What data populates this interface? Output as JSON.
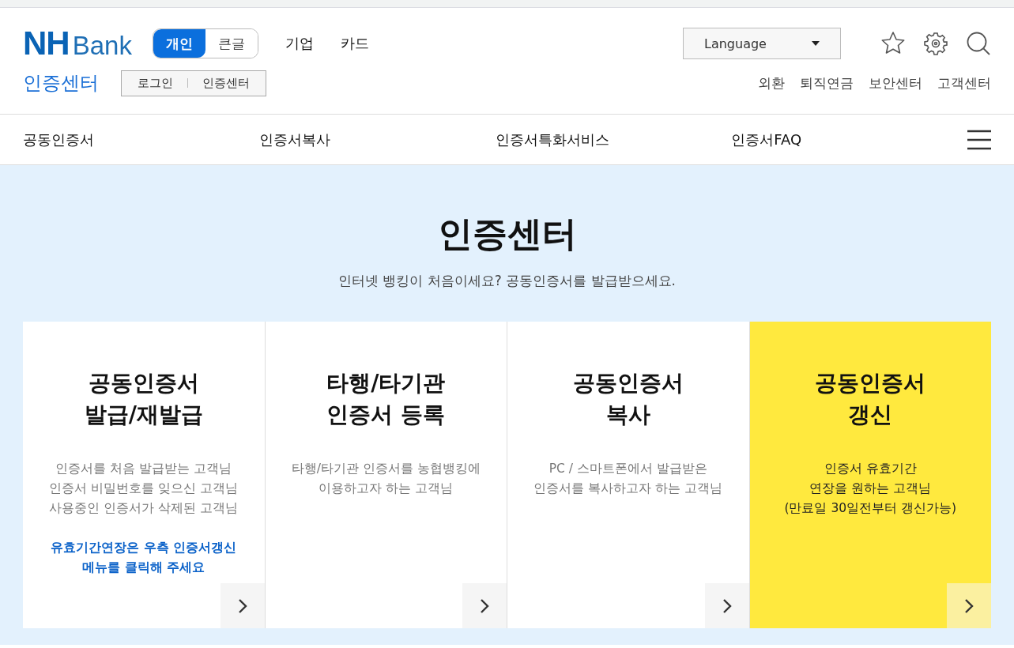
{
  "logo": {
    "mark": "NH",
    "word": "Bank"
  },
  "mode_toggle": [
    {
      "label": "개인",
      "selected": true
    },
    {
      "label": "큰글",
      "selected": false
    }
  ],
  "top_menu": [
    "기업",
    "카드"
  ],
  "language_select": {
    "value": "Language"
  },
  "section_title": "인증센터",
  "breadcrumb": [
    "로그인",
    "인증센터"
  ],
  "utility_links": [
    "외환",
    "퇴직연금",
    "보안센터",
    "고객센터"
  ],
  "nav": [
    "공동인증서",
    "인증서복사",
    "인증서특화서비스",
    "인증서FAQ"
  ],
  "hero": {
    "title": "인증센터",
    "subtitle": "인터넷 뱅킹이 처음이세요? 공동인증서를 발급받으세요."
  },
  "cards": [
    {
      "title": [
        "공동인증서",
        "발급/재발급"
      ],
      "description": [
        "인증서를 처음 발급받는 고객님",
        "인증서 비밀번호를 잊으신 고객님",
        "사용중인 인증서가 삭제된 고객님"
      ],
      "notice": [
        "유효기간연장은 우측 인증서갱신",
        "메뉴를 클릭해 주세요"
      ],
      "highlighted": false
    },
    {
      "title": [
        "타행/타기관",
        "인증서 등록"
      ],
      "description": [
        "타행/타기관 인증서를 농협뱅킹에",
        "이용하고자 하는 고객님"
      ],
      "highlighted": false
    },
    {
      "title": [
        "공동인증서",
        "복사"
      ],
      "description": [
        "PC / 스마트폰에서 발급받은",
        "인증서를 복사하고자 하는 고객님"
      ],
      "highlighted": false
    },
    {
      "title": [
        "공동인증서",
        "갱신"
      ],
      "description": [
        "인증서 유효기간",
        "연장을 원하는 고객님",
        "(만료일 30일전부터 갱신가능)"
      ],
      "highlighted": true
    }
  ]
}
